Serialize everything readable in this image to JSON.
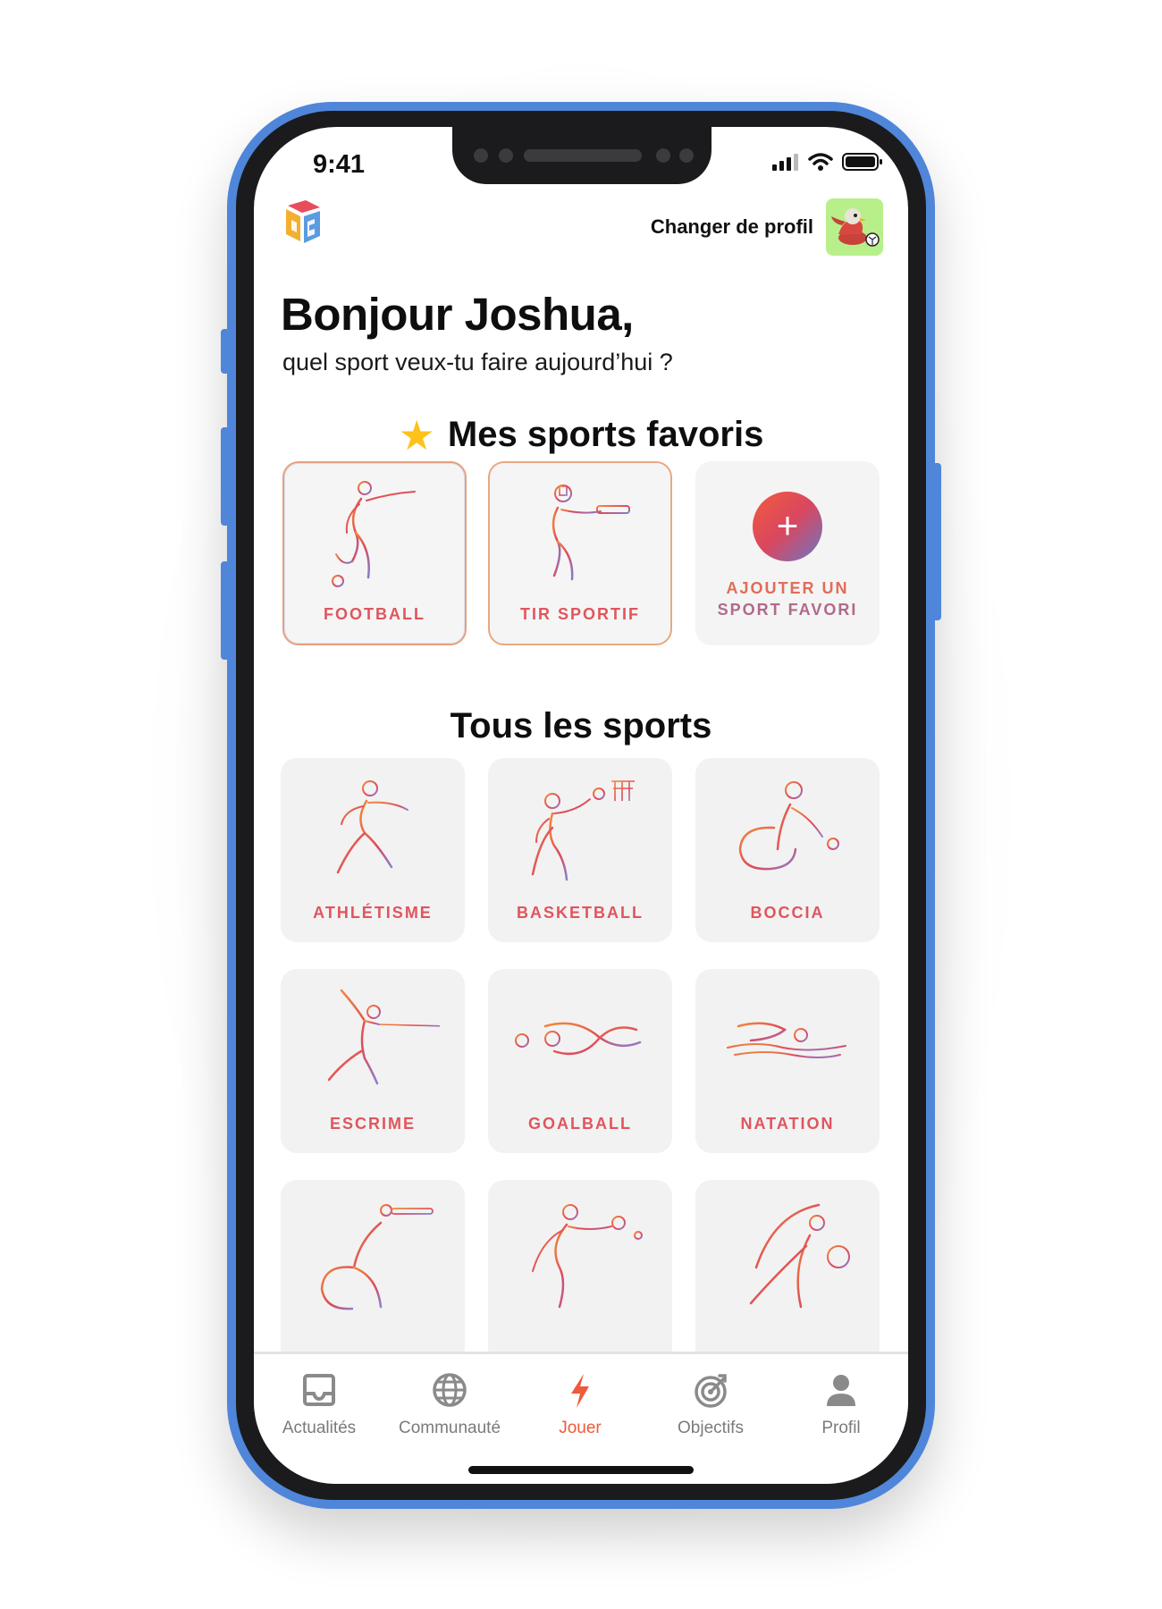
{
  "status": {
    "time": "9:41"
  },
  "header": {
    "profile_switch_label": "Changer de profil"
  },
  "greeting": {
    "title": "Bonjour Joshua,",
    "subtitle": "quel sport veux-tu faire aujourd’hui ?"
  },
  "favorites": {
    "title": "Mes sports favoris",
    "items": [
      {
        "label": "FOOTBALL",
        "icon": "football-player-icon"
      },
      {
        "label": "TIR SPORTIF",
        "icon": "shooting-icon"
      }
    ],
    "add_label_line1": "AJOUTER UN",
    "add_label_line2": "SPORT FAVORI",
    "add_symbol": "+"
  },
  "all_sports": {
    "title": "Tous les sports",
    "items": [
      {
        "label": "ATHLÉTISME",
        "icon": "athletics-icon"
      },
      {
        "label": "BASKETBALL",
        "icon": "basketball-icon"
      },
      {
        "label": "BOCCIA",
        "icon": "boccia-icon"
      },
      {
        "label": "ESCRIME",
        "icon": "fencing-icon"
      },
      {
        "label": "GOALBALL",
        "icon": "goalball-icon"
      },
      {
        "label": "NATATION",
        "icon": "swimming-icon"
      },
      {
        "label": "",
        "icon": "para-shooting-icon"
      },
      {
        "label": "",
        "icon": "table-tennis-icon"
      },
      {
        "label": "",
        "icon": "shot-put-icon"
      }
    ]
  },
  "tabbar": {
    "tabs": [
      {
        "label": "Actualités",
        "icon": "inbox-icon",
        "active": false
      },
      {
        "label": "Communauté",
        "icon": "globe-icon",
        "active": false
      },
      {
        "label": "Jouer",
        "icon": "lightning-icon",
        "active": true
      },
      {
        "label": "Objectifs",
        "icon": "target-icon",
        "active": false
      },
      {
        "label": "Profil",
        "icon": "user-icon",
        "active": false
      }
    ]
  },
  "colors": {
    "accent": "#f05a3a",
    "star": "#ffc21a",
    "frame": "#4f86d9",
    "card_bg": "#f2f2f2",
    "label": "#e0555d"
  }
}
